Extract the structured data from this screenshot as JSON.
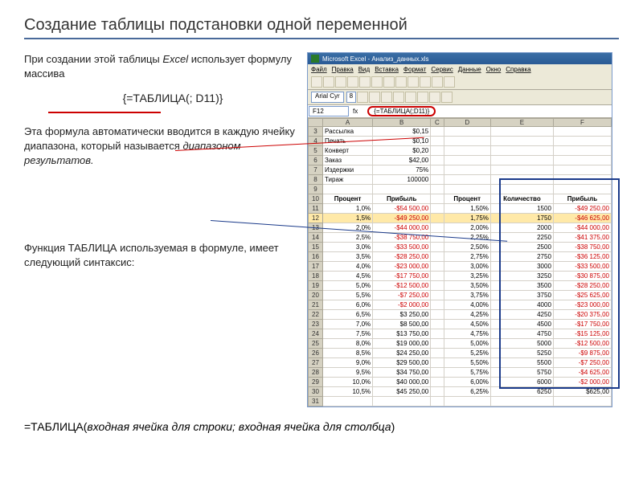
{
  "title": "Создание таблицы подстановки одной переменной",
  "para1a": "При создании этой таблицы ",
  "para1_em": "Excel",
  "para1b": " использует формулу массива",
  "formula": "{=ТАБЛИЦА(; D11)}",
  "para2a": "Эта формула автоматически вводится в каждую ячейку диапазона, который называется ",
  "para2_em": "диапазоном результатов.",
  "para3": "Функция ТАБЛИЦА используемая в формуле, имеет следующий синтаксис:",
  "syntax_a": "=ТАБЛИЦА(",
  "syntax_em1": "входная ячейка для строки; входная ячейка для столбца",
  "syntax_b": ")",
  "excel": {
    "window_title": "Microsoft Excel - Анализ_данных.xls",
    "menu": [
      "Файл",
      "Правка",
      "Вид",
      "Вставка",
      "Формат",
      "Сервис",
      "Данные",
      "Окно",
      "Справка"
    ],
    "font_name": "Arial Cyr",
    "font_size": "8",
    "name_box": "F12",
    "formula_bar": "{=ТАБЛИЦА(;D11)}",
    "cols": [
      "A",
      "B",
      "C",
      "D",
      "E",
      "F"
    ],
    "left_params": [
      {
        "r": "3",
        "l": "Рассылка",
        "v": "$0,15"
      },
      {
        "r": "4",
        "l": "Печать",
        "v": "$0,10"
      },
      {
        "r": "5",
        "l": "Конверт",
        "v": "$0,20"
      },
      {
        "r": "6",
        "l": "Заказ",
        "v": "$42,00"
      },
      {
        "r": "7",
        "l": "Издержки",
        "v": "75%"
      },
      {
        "r": "8",
        "l": "Тираж",
        "v": "100000"
      }
    ],
    "header_row": "10",
    "headers_left": [
      "Процент",
      "Прибыль"
    ],
    "headers_right": [
      "Процент",
      "Количество",
      "Прибыль"
    ],
    "rows": [
      {
        "r": "11",
        "lp": "1,0%",
        "lv": "-$54 500,00",
        "neg1": true,
        "rp": "1,50%",
        "rq": "1500",
        "rv": "-$49 250,00",
        "neg2": true
      },
      {
        "r": "12",
        "lp": "1,5%",
        "lv": "-$49 250,00",
        "neg1": true,
        "rp": "1,75%",
        "rq": "1750",
        "rv": "-$46 625,00",
        "neg2": true,
        "sel": true
      },
      {
        "r": "13",
        "lp": "2,0%",
        "lv": "-$44 000,00",
        "neg1": true,
        "rp": "2,00%",
        "rq": "2000",
        "rv": "-$44 000,00",
        "neg2": true
      },
      {
        "r": "14",
        "lp": "2,5%",
        "lv": "-$38 750,00",
        "neg1": true,
        "rp": "2,25%",
        "rq": "2250",
        "rv": "-$41 375,00",
        "neg2": true
      },
      {
        "r": "15",
        "lp": "3,0%",
        "lv": "-$33 500,00",
        "neg1": true,
        "rp": "2,50%",
        "rq": "2500",
        "rv": "-$38 750,00",
        "neg2": true
      },
      {
        "r": "16",
        "lp": "3,5%",
        "lv": "-$28 250,00",
        "neg1": true,
        "rp": "2,75%",
        "rq": "2750",
        "rv": "-$36 125,00",
        "neg2": true
      },
      {
        "r": "17",
        "lp": "4,0%",
        "lv": "-$23 000,00",
        "neg1": true,
        "rp": "3,00%",
        "rq": "3000",
        "rv": "-$33 500,00",
        "neg2": true
      },
      {
        "r": "18",
        "lp": "4,5%",
        "lv": "-$17 750,00",
        "neg1": true,
        "rp": "3,25%",
        "rq": "3250",
        "rv": "-$30 875,00",
        "neg2": true
      },
      {
        "r": "19",
        "lp": "5,0%",
        "lv": "-$12 500,00",
        "neg1": true,
        "rp": "3,50%",
        "rq": "3500",
        "rv": "-$28 250,00",
        "neg2": true
      },
      {
        "r": "20",
        "lp": "5,5%",
        "lv": "-$7 250,00",
        "neg1": true,
        "rp": "3,75%",
        "rq": "3750",
        "rv": "-$25 625,00",
        "neg2": true
      },
      {
        "r": "21",
        "lp": "6,0%",
        "lv": "-$2 000,00",
        "neg1": true,
        "rp": "4,00%",
        "rq": "4000",
        "rv": "-$23 000,00",
        "neg2": true
      },
      {
        "r": "22",
        "lp": "6,5%",
        "lv": "$3 250,00",
        "neg1": false,
        "rp": "4,25%",
        "rq": "4250",
        "rv": "-$20 375,00",
        "neg2": true
      },
      {
        "r": "23",
        "lp": "7,0%",
        "lv": "$8 500,00",
        "neg1": false,
        "rp": "4,50%",
        "rq": "4500",
        "rv": "-$17 750,00",
        "neg2": true
      },
      {
        "r": "24",
        "lp": "7,5%",
        "lv": "$13 750,00",
        "neg1": false,
        "rp": "4,75%",
        "rq": "4750",
        "rv": "-$15 125,00",
        "neg2": true
      },
      {
        "r": "25",
        "lp": "8,0%",
        "lv": "$19 000,00",
        "neg1": false,
        "rp": "5,00%",
        "rq": "5000",
        "rv": "-$12 500,00",
        "neg2": true
      },
      {
        "r": "26",
        "lp": "8,5%",
        "lv": "$24 250,00",
        "neg1": false,
        "rp": "5,25%",
        "rq": "5250",
        "rv": "-$9 875,00",
        "neg2": true
      },
      {
        "r": "27",
        "lp": "9,0%",
        "lv": "$29 500,00",
        "neg1": false,
        "rp": "5,50%",
        "rq": "5500",
        "rv": "-$7 250,00",
        "neg2": true
      },
      {
        "r": "28",
        "lp": "9,5%",
        "lv": "$34 750,00",
        "neg1": false,
        "rp": "5,75%",
        "rq": "5750",
        "rv": "-$4 625,00",
        "neg2": true
      },
      {
        "r": "29",
        "lp": "10,0%",
        "lv": "$40 000,00",
        "neg1": false,
        "rp": "6,00%",
        "rq": "6000",
        "rv": "-$2 000,00",
        "neg2": true
      },
      {
        "r": "30",
        "lp": "10,5%",
        "lv": "$45 250,00",
        "neg1": false,
        "rp": "6,25%",
        "rq": "6250",
        "rv": "$625,00",
        "neg2": false
      }
    ],
    "last_row": "31"
  }
}
